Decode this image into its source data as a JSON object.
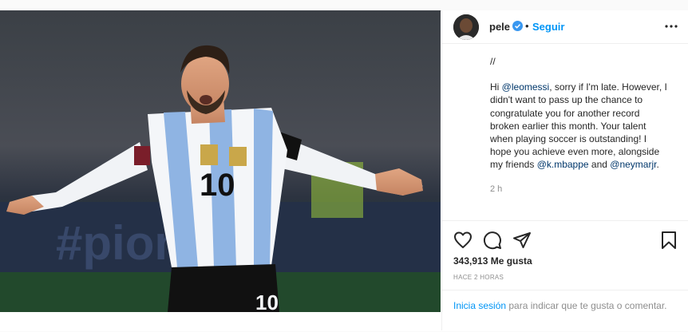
{
  "post": {
    "username": "pele",
    "follow_label": "Seguir",
    "separator": "•",
    "caption_lines": {
      "slash": "//",
      "p1": "Hi ",
      "mention1": "@leomessi",
      "p2": ", sorry if I'm late. However, I didn't want to pass up the chance to congratulate you for another record broken earlier this month. Your talent when playing soccer is outstanding! I hope you achieve even more, alongside my friends ",
      "mention2": "@k.mbappe",
      "p3": " and ",
      "mention3": "@neymarjr",
      "p4": "."
    },
    "time": "2 h",
    "likes": "343,913 Me gusta",
    "ago": "HACE 2 HORAS",
    "login_link": "Inicia sesión",
    "login_rest": " para indicar que te gusta o comentar."
  },
  "image": {
    "board_text": "#pion",
    "jersey_number": "10",
    "shorts_number": "10"
  },
  "colors": {
    "accent_blue": "#0095f6",
    "mention": "#00376b",
    "muted": "#8e8e8e",
    "text": "#262626",
    "jersey_stripe": "#8fb4e3"
  },
  "icons": [
    "verified-icon",
    "more-options-icon",
    "heart-icon",
    "comment-icon",
    "share-icon",
    "bookmark-icon"
  ]
}
